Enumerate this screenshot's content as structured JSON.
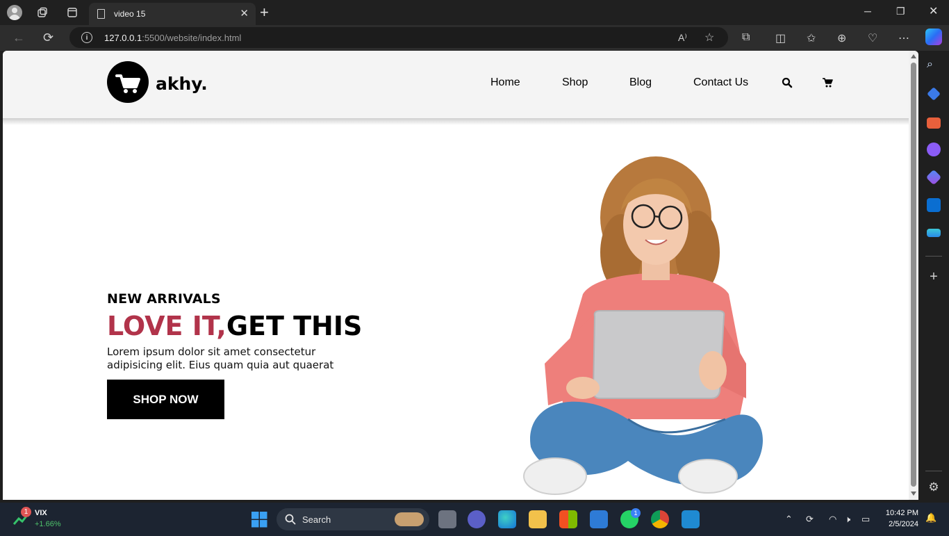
{
  "browser": {
    "tab_title": "video 15",
    "url_host": "127.0.0.1",
    "url_path": ":5500/website/index.html"
  },
  "site": {
    "brand": "akhy.",
    "nav": [
      "Home",
      "Shop",
      "Blog",
      "Contact Us"
    ],
    "hero": {
      "kicker": "NEW ARRIVALS",
      "title_accent": "LOVE IT,",
      "title_rest": "GET THIS",
      "description": "Lorem ipsum dolor sit amet consectetur adipisicing elit. Eius quam quia aut quaerat",
      "button": "SHOP NOW"
    },
    "colors": {
      "accent": "#b1334a",
      "header_bg": "#f4f4f4"
    }
  },
  "taskbar": {
    "widget_name": "VIX",
    "widget_change": "+1.66%",
    "widget_badge": "1",
    "search_label": "Search",
    "whatsapp_badge": "1",
    "time": "10:42 PM",
    "date": "2/5/2024"
  }
}
